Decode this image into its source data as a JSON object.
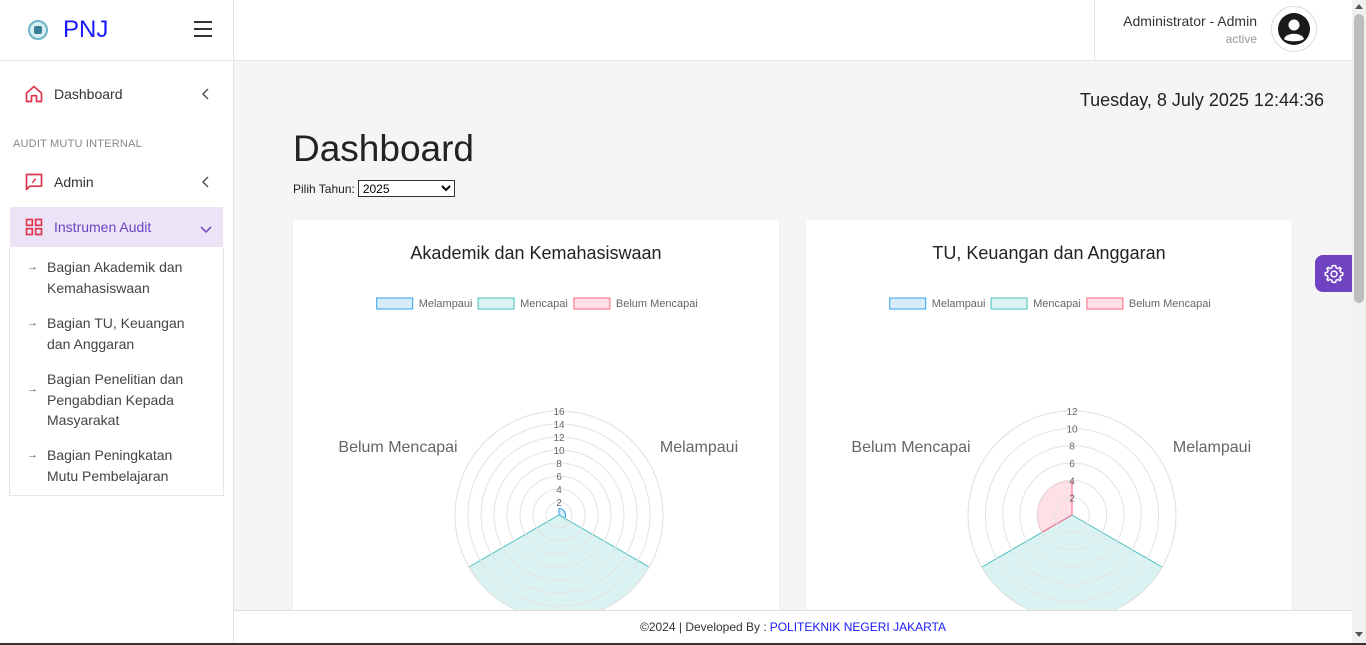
{
  "brand": {
    "name": "PNJ",
    "logo_icon": "pnj-logo-icon"
  },
  "sidebar": {
    "dashboard_label": "Dashboard",
    "section_label": "AUDIT MUTU INTERNAL",
    "admin_label": "Admin",
    "instrumen_label": "Instrumen Audit",
    "sub_items": [
      {
        "line1": "Bagian Akademik dan",
        "line2": "Kemahasiswaan"
      },
      {
        "line1": "Bagian TU, Keuangan",
        "line2": "dan Anggaran"
      },
      {
        "line1": "Bagian Penelitian dan",
        "line2": "Pengabdian Kepada",
        "line3": "Masyarakat"
      },
      {
        "line1": "Bagian Peningkatan",
        "line2": "Mutu Pembelajaran"
      }
    ],
    "sub_arrow": "→"
  },
  "header": {
    "user_name": "Administrator - Admin",
    "user_status": "active"
  },
  "main": {
    "datetime": "Tuesday, 8 July 2025 12:44:36",
    "title": "Dashboard",
    "year_label": "Pilih Tahun:",
    "year_value": "2025"
  },
  "colors": {
    "accent": "#6f42c1",
    "melampaui": "#36a2eb",
    "mencapai": "#4bc0c0",
    "belum_mencapai": "#ff6384"
  },
  "chart_data": [
    {
      "type": "polarArea",
      "title": "Akademik dan Kemahasiswaan",
      "legend_position": "top",
      "categories": [
        "Melampaui",
        "Mencapai",
        "Belum Mencapai"
      ],
      "values": [
        1,
        17,
        0
      ],
      "r_ticks": [
        "2",
        "4",
        "6",
        "8",
        "10",
        "12",
        "14",
        "16"
      ],
      "r_max": 16
    },
    {
      "type": "polarArea",
      "title": "TU, Keuangan dan Anggaran",
      "legend_position": "top",
      "categories": [
        "Melampaui",
        "Mencapai",
        "Belum Mencapai"
      ],
      "values": [
        0,
        14,
        4
      ],
      "r_ticks": [
        "2",
        "4",
        "6",
        "8",
        "10",
        "12"
      ],
      "r_max": 12
    }
  ],
  "footer": {
    "text": "©2024 | Developed By :",
    "link": "POLITEKNIK NEGERI JAKARTA"
  }
}
